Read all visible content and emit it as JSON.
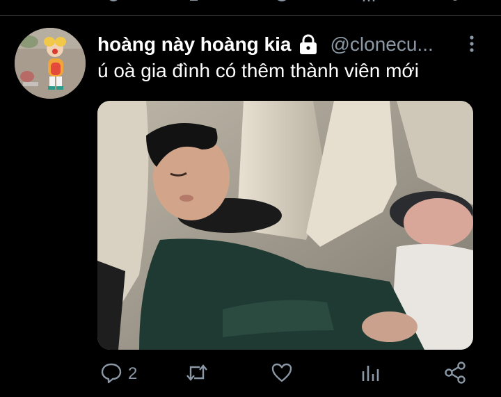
{
  "tweet": {
    "display_name": "hoàng này hoàng kia",
    "handle": "@clonecu...",
    "text": "ú oà gia đình có thêm thành viên mới"
  },
  "actions": {
    "reply_count": "2"
  },
  "icons": {
    "lock": "lock-icon",
    "more": "more-vertical-icon",
    "reply": "reply-icon",
    "retweet": "retweet-icon",
    "like": "heart-icon",
    "analytics": "analytics-icon",
    "share": "share-icon"
  },
  "colors": {
    "background": "#000000",
    "secondary_text": "#8b98a5",
    "icon": "#8b98a5",
    "divider": "#2f3336"
  }
}
